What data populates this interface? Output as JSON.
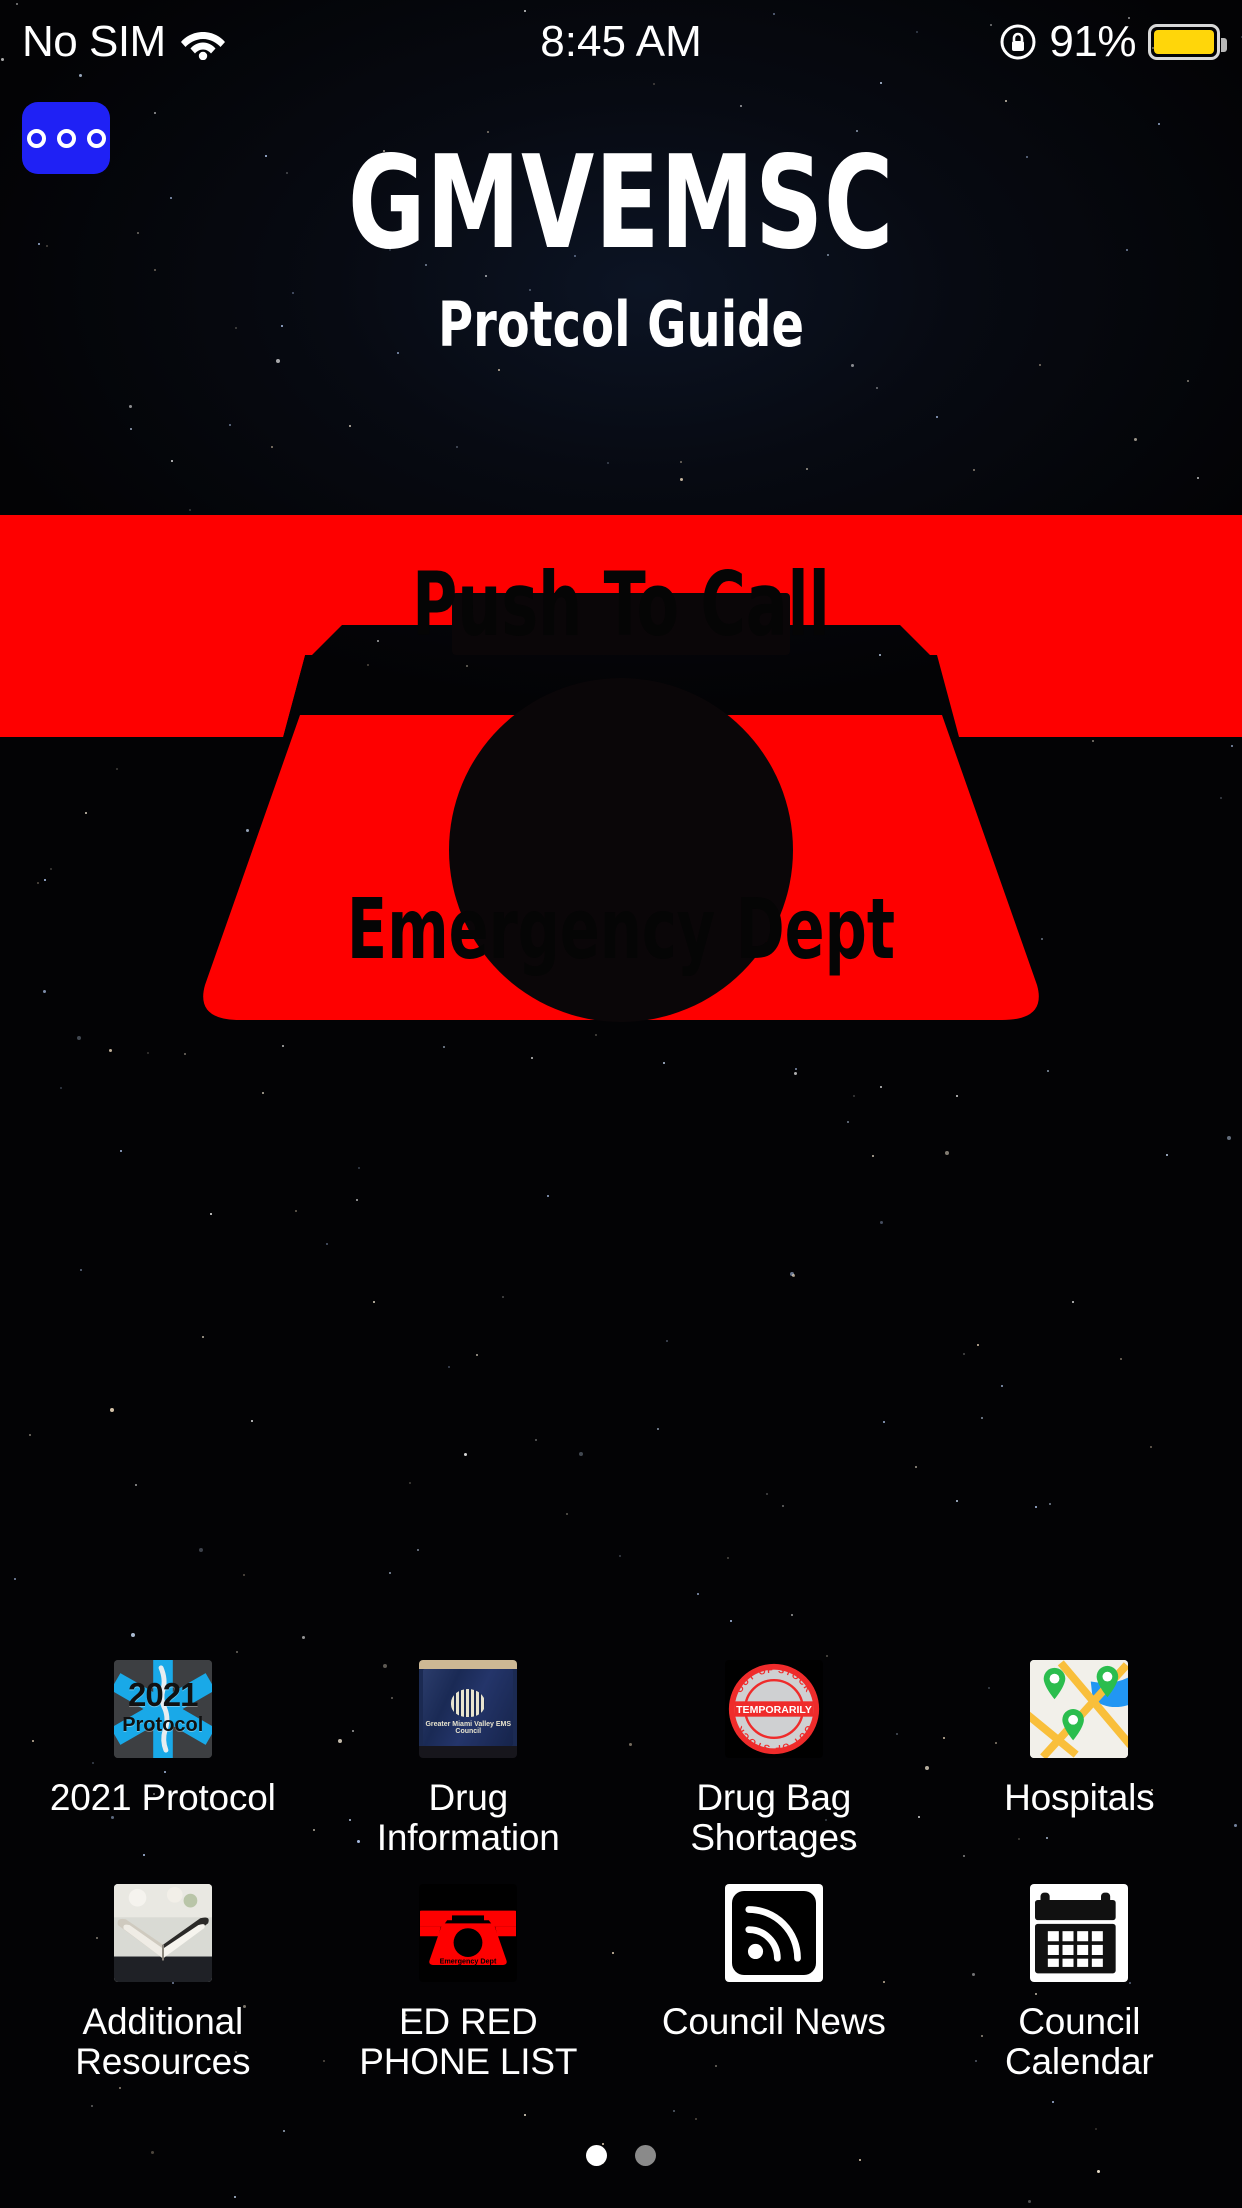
{
  "status_bar": {
    "carrier": "No SIM",
    "wifi_icon": "wifi-icon",
    "time": "8:45 AM",
    "orientation_lock_icon": "rotation-lock-icon",
    "battery_percent": "91%",
    "battery_color": "#ffd60a"
  },
  "more_button": {
    "icon": "ellipsis-icon"
  },
  "header": {
    "title": "GMVEMSC",
    "subtitle": "Protcol Guide"
  },
  "hero": {
    "icon": "red-telephone-icon",
    "top_label": "Push To Call",
    "bottom_label": "Emergency Dept",
    "color": "#fe0000"
  },
  "apps": [
    {
      "label": "2021 Protocol",
      "icon": "star-of-life-protocol-icon",
      "icon_text_primary": "2021",
      "icon_text_secondary": "Protocol",
      "icon_color": "#29b6f6"
    },
    {
      "label": "Drug Information",
      "icon": "drug-bag-photo-icon",
      "icon_text": "Greater Miami Valley EMS Council",
      "icon_color": "#1b2a52"
    },
    {
      "label": "Drug Bag Shortages",
      "icon": "out-of-stock-stamp-icon",
      "stamp_outer_text": "OUT OF STOCK",
      "stamp_inner_text": "TEMPORARILY",
      "icon_color": "#ef2b2b"
    },
    {
      "label": "Hospitals",
      "icon": "map-pins-icon",
      "icon_color": "#34a853"
    },
    {
      "label": "Additional Resources",
      "icon": "open-book-photo-icon",
      "icon_color": "#e8e6e0"
    },
    {
      "label": "ED RED PHONE LIST",
      "icon": "red-telephone-icon",
      "icon_color": "#fe0000"
    },
    {
      "label": "Council News",
      "icon": "rss-feed-icon",
      "icon_color": "#000000"
    },
    {
      "label": "Council Calendar",
      "icon": "calendar-icon",
      "icon_color": "#000000"
    }
  ],
  "page_dots": {
    "total": 2,
    "active_index": 0
  }
}
